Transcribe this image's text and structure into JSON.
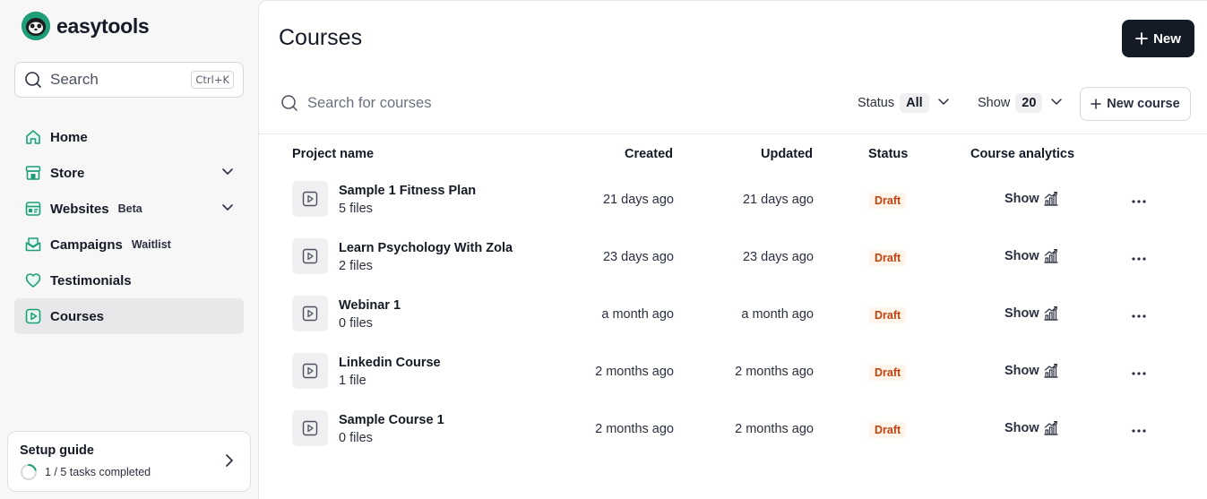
{
  "brand": {
    "name": "easytools",
    "accent": "#1f9e7a"
  },
  "sidebar": {
    "search": {
      "placeholder": "Search",
      "shortcut": "Ctrl+K"
    },
    "items": [
      {
        "label": "Home",
        "icon": "home-icon",
        "tag": ""
      },
      {
        "label": "Store",
        "icon": "store-icon",
        "tag": "",
        "expandable": true
      },
      {
        "label": "Websites",
        "icon": "websites-icon",
        "tag": "Beta",
        "expandable": true
      },
      {
        "label": "Campaigns",
        "icon": "campaigns-icon",
        "tag": "Waitlist"
      },
      {
        "label": "Testimonials",
        "icon": "heart-icon",
        "tag": ""
      },
      {
        "label": "Courses",
        "icon": "courses-icon",
        "tag": "",
        "active": true
      }
    ],
    "setup": {
      "title": "Setup guide",
      "progress_text": "1 / 5 tasks completed",
      "completed": 1,
      "total": 5
    }
  },
  "main": {
    "title": "Courses",
    "new_button": "New",
    "search_placeholder": "Search for courses",
    "filters": {
      "status_label": "Status",
      "status_value": "All",
      "show_label": "Show",
      "show_value": "20"
    },
    "new_course_button": "New course",
    "columns": {
      "project_name": "Project name",
      "created": "Created",
      "updated": "Updated",
      "status": "Status",
      "analytics": "Course analytics"
    },
    "rows": [
      {
        "name": "Sample 1 Fitness Plan",
        "files": "5 files",
        "created": "21 days ago",
        "updated": "21 days ago",
        "status": "Draft",
        "analytics": "Show"
      },
      {
        "name": "Learn Psychology With Zola",
        "files": "2 files",
        "created": "23 days ago",
        "updated": "23 days ago",
        "status": "Draft",
        "analytics": "Show"
      },
      {
        "name": "Webinar 1",
        "files": "0 files",
        "created": "a month ago",
        "updated": "a month ago",
        "status": "Draft",
        "analytics": "Show"
      },
      {
        "name": "Linkedin Course",
        "files": "1 file",
        "created": "2 months ago",
        "updated": "2 months ago",
        "status": "Draft",
        "analytics": "Show"
      },
      {
        "name": "Sample Course 1",
        "files": "0 files",
        "created": "2 months ago",
        "updated": "2 months ago",
        "status": "Draft",
        "analytics": "Show"
      }
    ]
  }
}
